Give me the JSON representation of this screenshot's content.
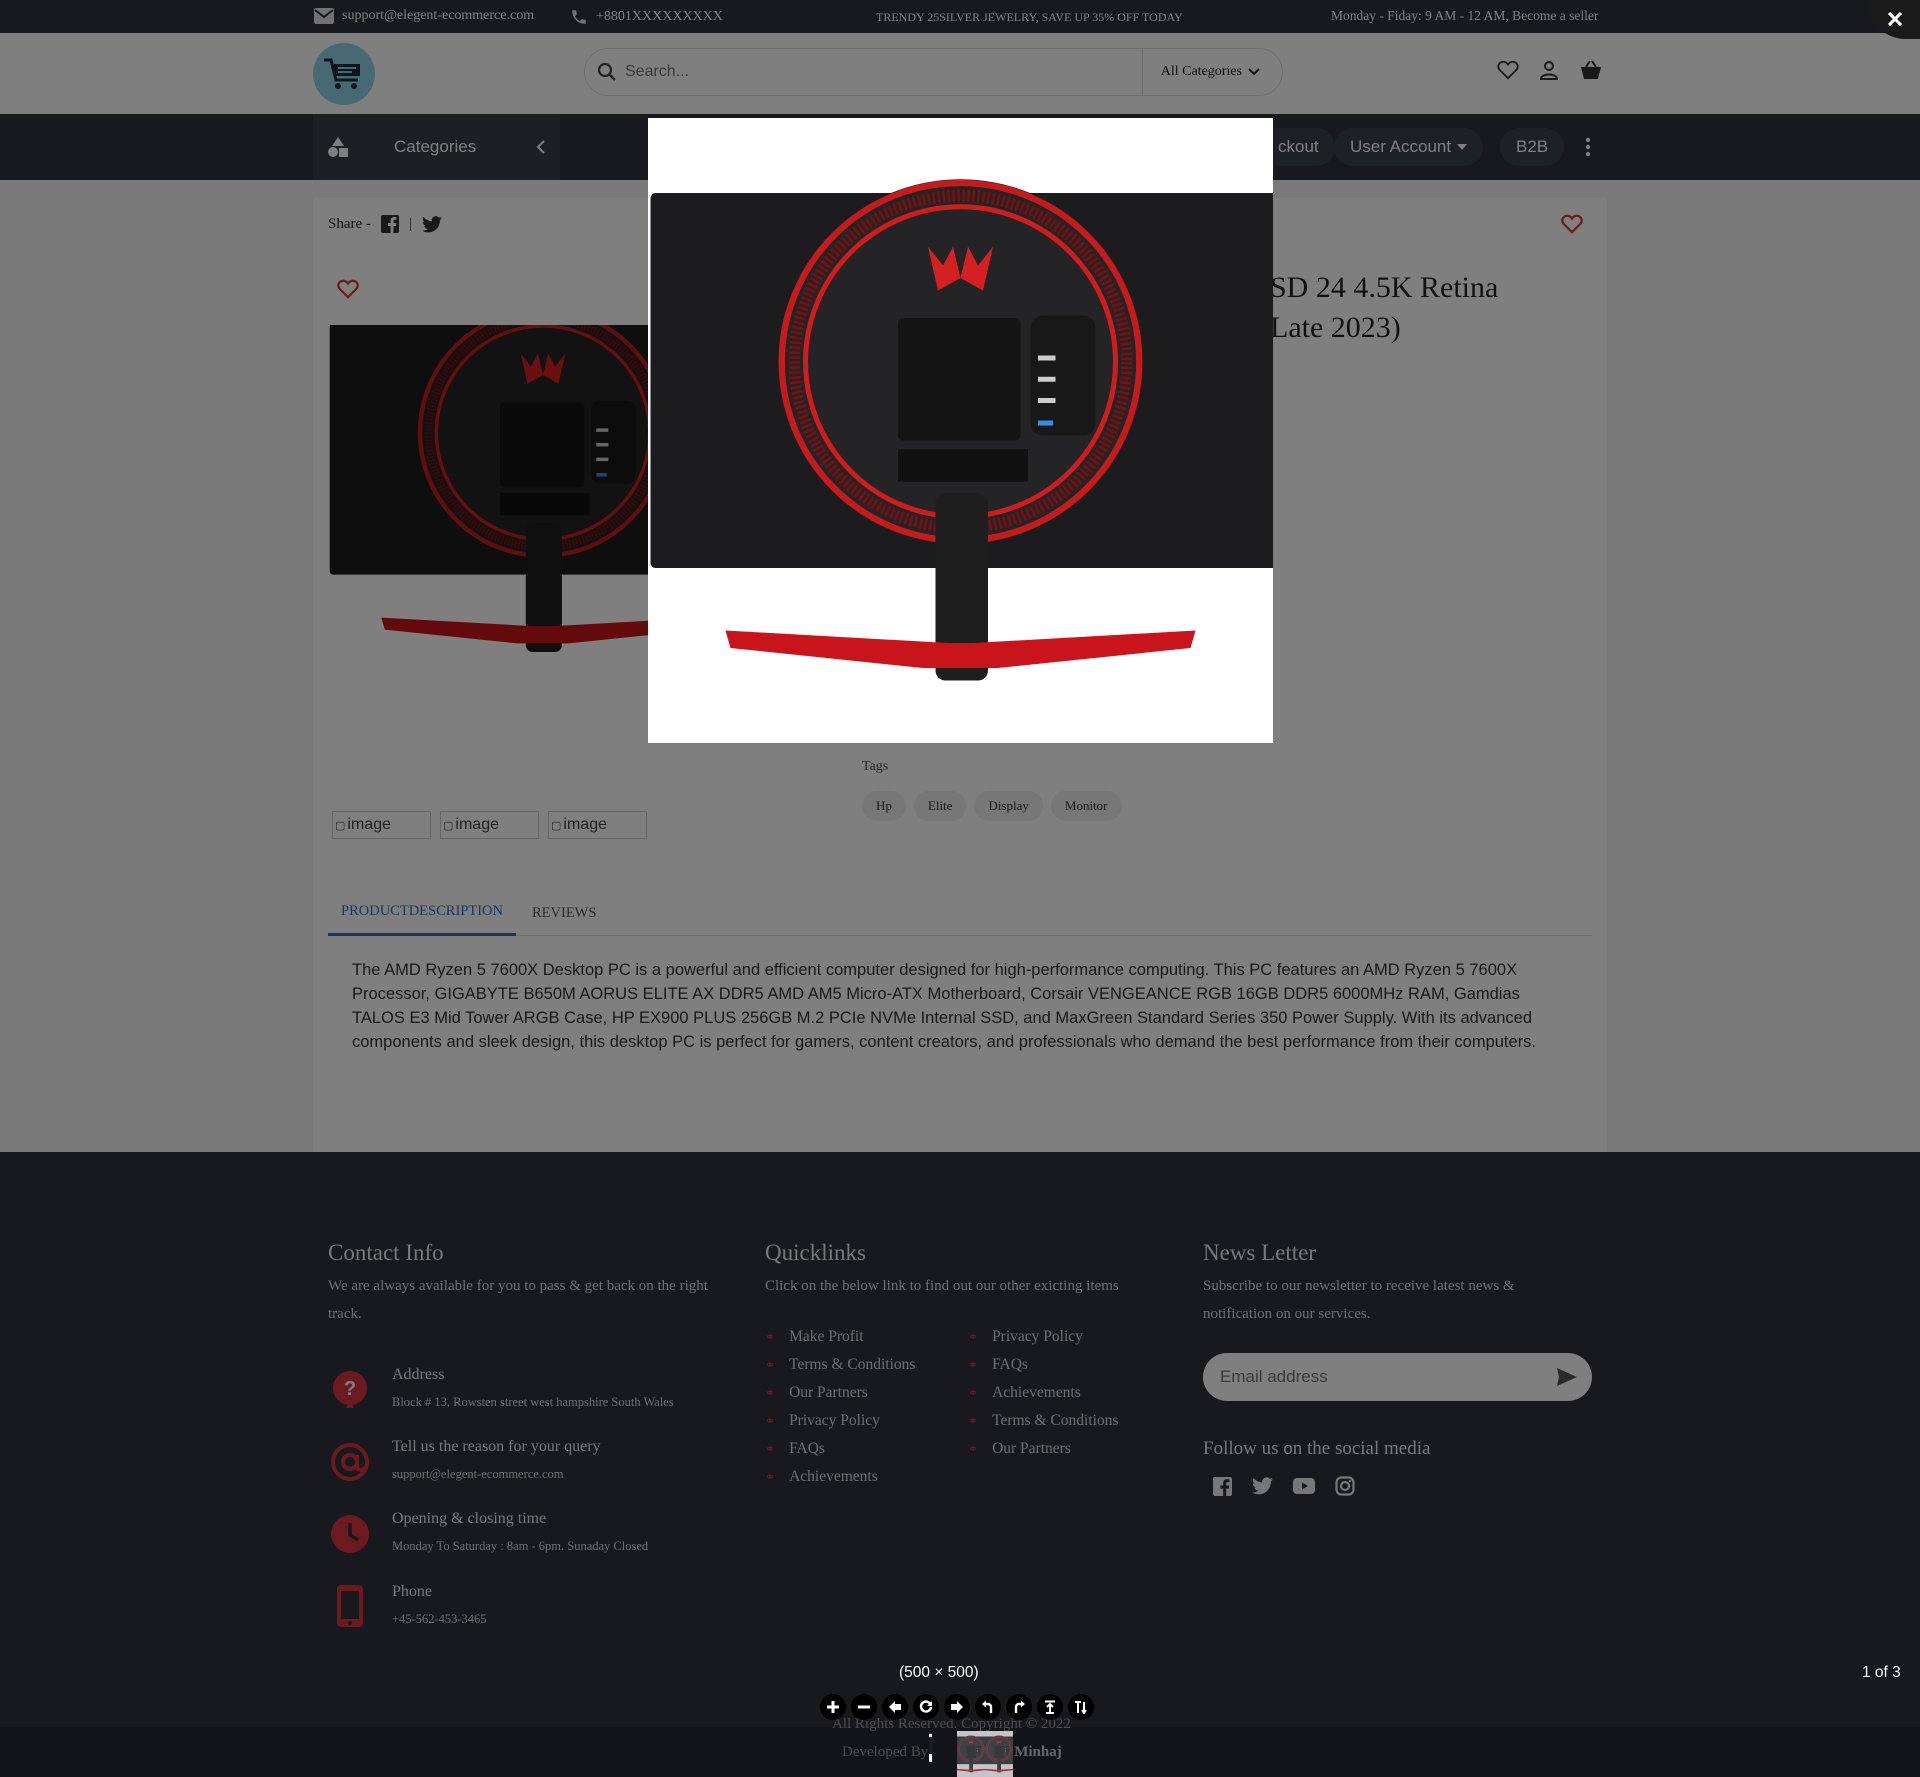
{
  "topbar": {
    "email": "support@elegent-ecommerce.com",
    "phone": "+8801XXXXXXXXX",
    "promo": "TRENDY 25SILVER JEWELRY, SAVE UP 35% OFF TODAY",
    "hours": "Monday - Fiday: 9 AM - 12 AM, Become a seller"
  },
  "header": {
    "search_placeholder": "Search...",
    "category_select": "All Categories"
  },
  "nav": {
    "categories": "Categories",
    "checkout": "ckout",
    "user_account": "User Account",
    "b2b": "B2B"
  },
  "product": {
    "share_label": "Share -",
    "title_line1": "SD 24 4.5K Retina",
    "title_line2": "Late 2023)",
    "tags_label": "Tags",
    "tags": [
      "Hp",
      "Elite",
      "Display",
      "Monitor"
    ],
    "thumb_alt": [
      "image",
      "image",
      "image"
    ],
    "tabs": [
      "PRODUCTDESCRIPTION",
      "REVIEWS"
    ],
    "description": "The AMD Ryzen 5 7600X Desktop PC is a powerful and efficient computer designed for high-performance computing. This PC features an AMD Ryzen 5 7600X Processor, GIGABYTE B650M AORUS ELITE AX DDR5 AMD AM5 Micro-ATX Motherboard, Corsair VENGEANCE RGB 16GB DDR5 6000MHz RAM, Gamdias TALOS E3 Mid Tower ARGB Case, HP EX900 PLUS 256GB M.2 PCIe NVMe Internal SSD, and MaxGreen Standard Series 350 Power Supply. With its advanced components and sleek design, this desktop PC is perfect for gamers, content creators, and professionals who demand the best performance from their computers."
  },
  "footer": {
    "contact": {
      "heading": "Contact Info",
      "text": "We are always available for you to pass & get back on the right track.",
      "items": [
        {
          "title": "Address",
          "value": "Block # 13, Rowsten street west hampshire South Wales"
        },
        {
          "title": "Tell us the reason for your query",
          "value": "support@elegent-ecommerce.com"
        },
        {
          "title": "Opening & closing time",
          "value": "Monday To Saturday : 8am - 6pm. Sunaday Closed"
        },
        {
          "title": "Phone",
          "value": "+45-562-453-3465"
        }
      ]
    },
    "quicklinks": {
      "heading": "Quicklinks",
      "text": "Click on the below link to find out our other exicting items",
      "col1": [
        "Make Profit",
        "Terms & Conditions",
        "Our Partners",
        "Privacy Policy",
        "FAQs",
        "Achievements"
      ],
      "col2": [
        "Privacy Policy",
        "FAQs",
        "Achievements",
        "Terms & Conditions",
        "Our Partners"
      ]
    },
    "newsletter": {
      "heading": "News Letter",
      "text": "Subscribe to our newsletter to receive latest news & notification on our services.",
      "placeholder": "Email address",
      "follow": "Follow us on the social media"
    },
    "copyright": "All Rights Reserved. Copyright © 2022",
    "developed_by": "Developed By",
    "developer": "Minhaj"
  },
  "viewer": {
    "dimensions": "(500 × 500)",
    "counter": "1 of 3",
    "tools": [
      "zoom-in-icon",
      "zoom-out-icon",
      "prev-icon",
      "reset-icon",
      "next-icon",
      "rotate-left-icon",
      "rotate-right-icon",
      "flip-vertical-icon",
      "flip-horizontal-icon"
    ]
  },
  "colors": {
    "dark": "#2f333a",
    "accent_red": "#d8343f",
    "tab_blue": "#2f6fbf"
  }
}
